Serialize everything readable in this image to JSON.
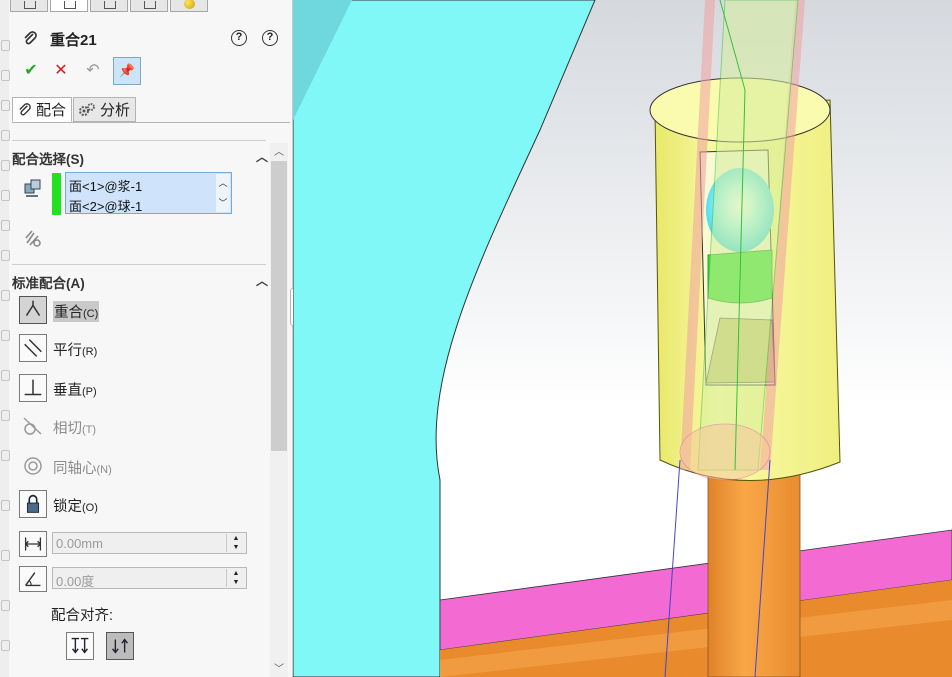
{
  "feature": {
    "title": "重合21",
    "actions": {
      "ok": "✔",
      "cancel": "✕",
      "undo": "↶",
      "pin": "📌"
    },
    "help_labels": [
      "?",
      "?"
    ]
  },
  "tabs": [
    {
      "label": "配合",
      "icon": "paperclip-icon",
      "active": true
    },
    {
      "label": "分析",
      "icon": "gears-icon",
      "active": false
    }
  ],
  "mate_selection": {
    "heading": "配合选择(S)",
    "items": [
      "面<1>@浆-1",
      "面<2>@球-1"
    ]
  },
  "standard_mates": {
    "heading": "标准配合(A)",
    "items": [
      {
        "label": "重合",
        "key": "(C)",
        "icon": "coincident-icon",
        "selected": true,
        "enabled": true
      },
      {
        "label": "平行",
        "key": "(R)",
        "icon": "parallel-icon",
        "selected": false,
        "enabled": true
      },
      {
        "label": "垂直",
        "key": "(P)",
        "icon": "perpendicular-icon",
        "selected": false,
        "enabled": true
      },
      {
        "label": "相切",
        "key": "(T)",
        "icon": "tangent-icon",
        "selected": false,
        "enabled": false
      },
      {
        "label": "同轴心",
        "key": "(N)",
        "icon": "concentric-icon",
        "selected": false,
        "enabled": false
      },
      {
        "label": "锁定",
        "key": "(O)",
        "icon": "lock-icon",
        "selected": false,
        "enabled": true
      }
    ],
    "distance_value": "0.00mm",
    "angle_value": "0.00度",
    "alignment_label": "配合对齐:"
  },
  "colors": {
    "accent_green": "#22e022",
    "selection_blue": "#cfe3fa",
    "cyan_part": "#80f8f8",
    "yellow_part": "#f2f28a",
    "orange_part": "#f39a3a",
    "magenta_part": "#f26ad2"
  }
}
